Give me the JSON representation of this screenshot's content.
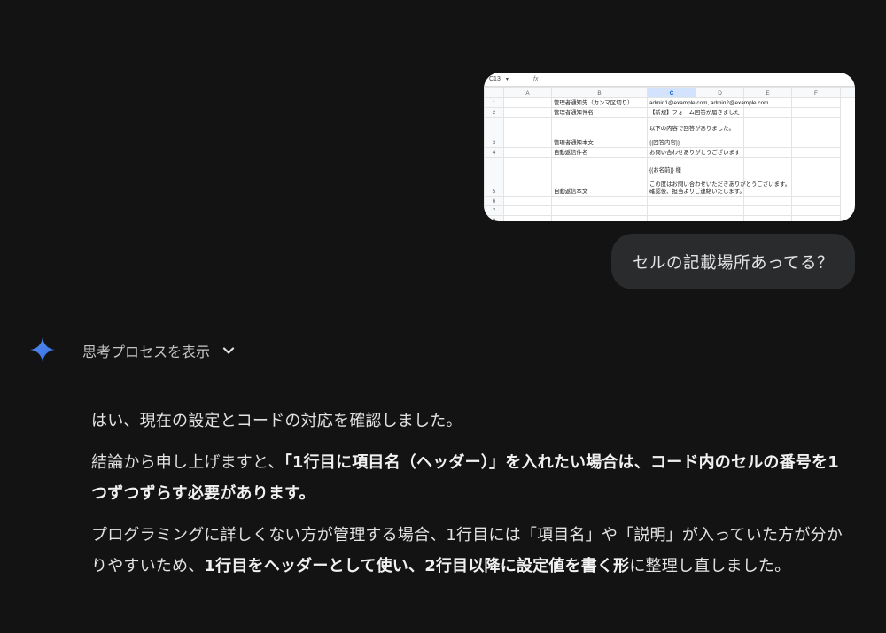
{
  "attachment": {
    "cell_ref": "C13",
    "fx": "fx",
    "columns": [
      "",
      "A",
      "B",
      "C",
      "D",
      "E",
      "F"
    ],
    "selected_column": "C",
    "rows": [
      {
        "n": "1",
        "a": "",
        "b": "管理者通知先（カンマ区切り）",
        "c": "admin1@example.com, admin2@example.com"
      },
      {
        "n": "2",
        "a": "",
        "b": "管理者通知件名",
        "c": "【新規】フォーム回答が届きました"
      },
      {
        "n": "3",
        "a": "",
        "b": "管理者通知本文",
        "c": "以下の内容で回答がありました。\n\n{{回答内容}}"
      },
      {
        "n": "4",
        "a": "",
        "b": "自動返信件名",
        "c": "お問い合わせありがとうございます"
      },
      {
        "n": "5",
        "a": "",
        "b": "自動返信本文",
        "c": "{{お名前}} 様\n\nこの度はお問い合わせいただきありがとうございます。\n確認後、担当よりご連絡いたします。"
      },
      {
        "n": "6",
        "a": "",
        "b": "",
        "c": ""
      },
      {
        "n": "7",
        "a": "",
        "b": "",
        "c": ""
      },
      {
        "n": "8",
        "a": "",
        "b": "",
        "c": ""
      }
    ]
  },
  "user_message": "セルの記載場所あってる？",
  "thinking": {
    "label": "思考プロセスを表示",
    "icon": "chevron-down-icon",
    "spark_icon": "gemini-spark-icon",
    "spark_color": "#4285f4"
  },
  "reply": {
    "p1": "はい、現在の設定とコードの対応を確認しました。",
    "p2_pre": "結論から申し上げますと、",
    "p2_bold": "「1行目に項目名（ヘッダー）」を入れたい場合は、コード内のセルの番号を1つずつずらす必要があります。",
    "p3_pre": "プログラミングに詳しくない方が管理する場合、1行目には「項目名」や「説明」が入っていた方が分かりやすいため、",
    "p3_bold": "1行目をヘッダーとして使い、2行目以降に設定値を書く形",
    "p3_post": "に整理し直しました。"
  },
  "colors": {
    "background": "#131314",
    "bubble": "#2a2b2d",
    "text": "#e3e3e3"
  }
}
